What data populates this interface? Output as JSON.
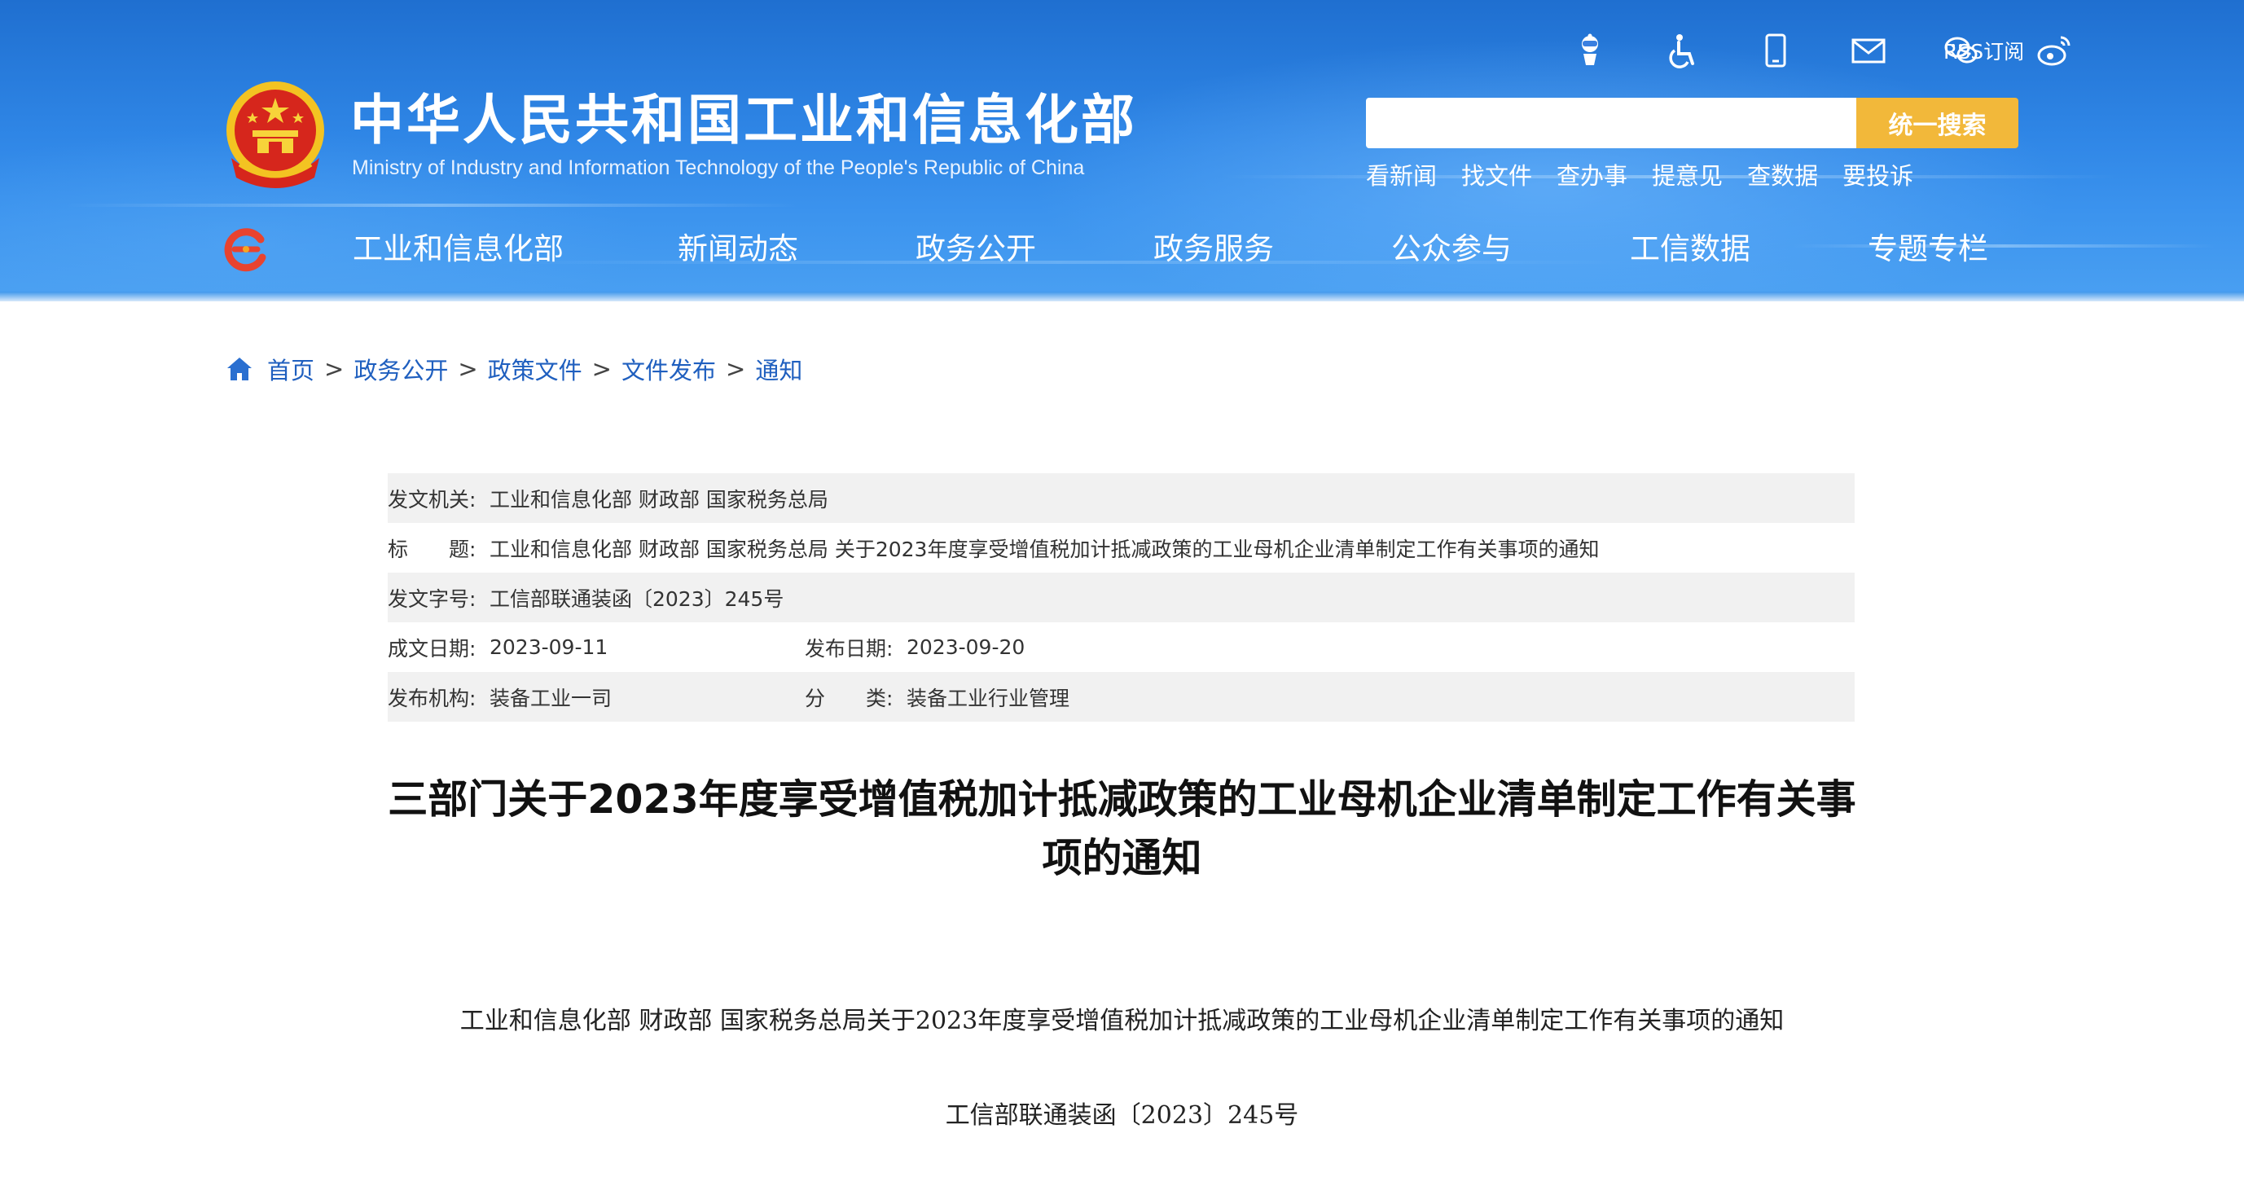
{
  "header": {
    "site_name_cn": "中华人民共和国工业和信息化部",
    "site_name_en": "Ministry of Industry and Information Technology of the People's Republic of China",
    "utility_icons": [
      "robot-assistant-icon",
      "accessibility-icon",
      "mobile-icon",
      "mail-icon",
      "wechat-icon",
      "weibo-icon"
    ],
    "rss_label": "RSS订阅",
    "search": {
      "value": "",
      "placeholder": "",
      "button_label": "统一搜索"
    },
    "quick_links": [
      "看新闻",
      "找文件",
      "查办事",
      "提意见",
      "查数据",
      "要投诉"
    ],
    "nav": [
      "工业和信息化部",
      "新闻动态",
      "政务公开",
      "政务服务",
      "公众参与",
      "工信数据",
      "专题专栏"
    ]
  },
  "breadcrumb": {
    "items": [
      "首页",
      "政务公开",
      "政策文件",
      "文件发布",
      "通知"
    ],
    "separator": ">"
  },
  "info": {
    "issuer_label": "发文机关:",
    "issuer": "工业和信息化部 财政部 国家税务总局",
    "title_label": "标　　题:",
    "title": "工业和信息化部 财政部 国家税务总局 关于2023年度享受增值税加计抵减政策的工业母机企业清单制定工作有关事项的通知",
    "doc_no_label": "发文字号:",
    "doc_no": "工信部联通装函〔2023〕245号",
    "created_label": "成文日期:",
    "created": "2023-09-11",
    "published_label": "发布日期:",
    "published": "2023-09-20",
    "org_label": "发布机构:",
    "org": "装备工业一司",
    "category_label": "分　　类:",
    "category": "装备工业行业管理"
  },
  "article": {
    "title": "三部门关于2023年度享受增值税加计抵减政策的工业母机企业清单制定工作有关事项的通知",
    "subtitle": "工业和信息化部 财政部 国家税务总局关于2023年度享受增值税加计抵减政策的工业母机企业清单制定工作有关事项的通知",
    "doc_number": "工信部联通装函〔2023〕245号"
  },
  "colors": {
    "header_blue": "#2f86e6",
    "search_button": "#f2b83a",
    "link_blue": "#1f5fbf",
    "row_grey": "#f1f1f1"
  }
}
